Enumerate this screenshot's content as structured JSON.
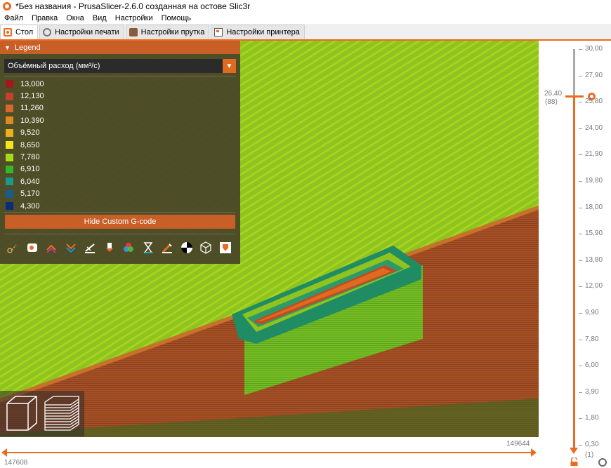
{
  "window": {
    "title": "*Без названия - PrusaSlicer-2.6.0 созданная на остове Slic3r"
  },
  "menu": [
    "Файл",
    "Правка",
    "Окна",
    "Вид",
    "Настройки",
    "Помощь"
  ],
  "tabs": [
    {
      "label": "Стол",
      "icon": "plater-icon"
    },
    {
      "label": "Настройки печати",
      "icon": "gear-icon"
    },
    {
      "label": "Настройки прутка",
      "icon": "spool-icon"
    },
    {
      "label": "Настройки принтера",
      "icon": "printer-icon"
    }
  ],
  "legend": {
    "title": "Legend",
    "metric": "Объёмный расход (мм³/с)",
    "items": [
      {
        "value": "13,000",
        "color": "#a11a1a"
      },
      {
        "value": "12,130",
        "color": "#c4412b"
      },
      {
        "value": "11,260",
        "color": "#d5682a"
      },
      {
        "value": "10,390",
        "color": "#df8a21"
      },
      {
        "value": "9,520",
        "color": "#ebb11b"
      },
      {
        "value": "8,650",
        "color": "#f3e61b"
      },
      {
        "value": "7,780",
        "color": "#a9d81b"
      },
      {
        "value": "6,910",
        "color": "#34b629"
      },
      {
        "value": "6,040",
        "color": "#1a9a8a"
      },
      {
        "value": "5,170",
        "color": "#165c8e"
      },
      {
        "value": "4,300",
        "color": "#0b2c7a"
      }
    ],
    "hide_button": "Hide Custom G-code",
    "tools": [
      "travel-icon",
      "wipe-icon",
      "retractions-icon",
      "deretractions-icon",
      "seams-icon",
      "tool-changes-icon",
      "color-changes-icon",
      "pause-icon",
      "custom-gcode-icon",
      "center-of-gravity-icon",
      "shells-icon",
      "tool-marker-icon"
    ]
  },
  "view_toggle": {
    "left_icon": "3d-view-icon",
    "right_icon": "layers-view-icon"
  },
  "hslider": {
    "left_label": "147608",
    "right_label": "149644"
  },
  "vslider": {
    "ticks": [
      "30,00",
      "27,90",
      "25,80",
      "24,00",
      "21,90",
      "19,80",
      "18,00",
      "15,90",
      "13,80",
      "12,00",
      "9,90",
      "7,80",
      "6,00",
      "3,90",
      "1,80",
      "0,30"
    ],
    "current_value": "26,40",
    "current_index": "(88)",
    "bottom_index": "(1)"
  },
  "colors": {
    "accent": "#ed6b21",
    "extrusion_green": "#8fc31f",
    "extrusion_brown": "#a54f24"
  }
}
